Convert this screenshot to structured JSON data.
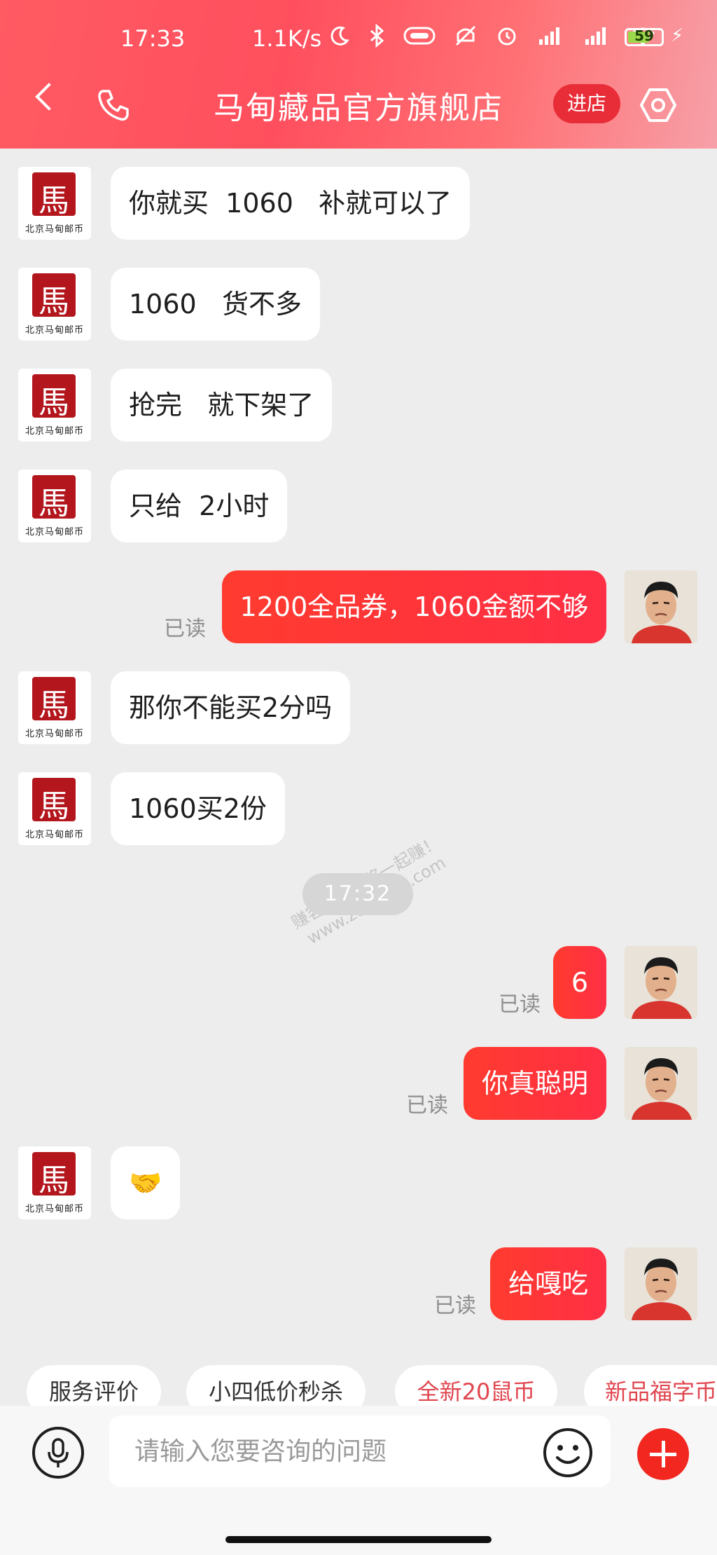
{
  "status_bar": {
    "time": "17:33",
    "network_speed": "1.1K/s",
    "battery_level": "59",
    "battery_percent": 59
  },
  "header": {
    "title": "马甸藏品官方旗舰店",
    "enter_store_label": "进店",
    "accent_color": "#ff4f5e"
  },
  "shop_avatar": {
    "seal_char": "馬",
    "caption": "北京马甸邮币"
  },
  "messages": [
    {
      "sender": "shop",
      "text": "你就买  1060   补就可以了"
    },
    {
      "sender": "shop",
      "text": "1060   货不多"
    },
    {
      "sender": "shop",
      "text": "抢完   就下架了"
    },
    {
      "sender": "shop",
      "text": "只给  2小时"
    },
    {
      "sender": "user",
      "text": "1200全品券，1060金额不够",
      "status": "已读"
    },
    {
      "sender": "shop",
      "text": "那你不能买2分吗"
    },
    {
      "sender": "shop",
      "text": "1060买2份"
    },
    {
      "sender": "user",
      "text": "6",
      "status": "已读"
    },
    {
      "sender": "user",
      "text": "你真聪明",
      "status": "已读"
    },
    {
      "sender": "shop",
      "text": "🤝"
    },
    {
      "sender": "user",
      "text": "给嘎吃",
      "status": "已读"
    }
  ],
  "time_separator": "17:32",
  "watermark": {
    "line1": "赚客吧，有奖一起赚！",
    "line2": "www.zuanke8.com"
  },
  "quick_chips": [
    {
      "label": "服务评价",
      "color": "#333333"
    },
    {
      "label": "小四低价秒杀",
      "color": "#333333"
    },
    {
      "label": "全新20鼠币",
      "color": "#e0454e"
    },
    {
      "label": "新品福字币",
      "color": "#e0454e"
    }
  ],
  "input": {
    "placeholder": "请输入您要咨询的问题",
    "value": ""
  }
}
